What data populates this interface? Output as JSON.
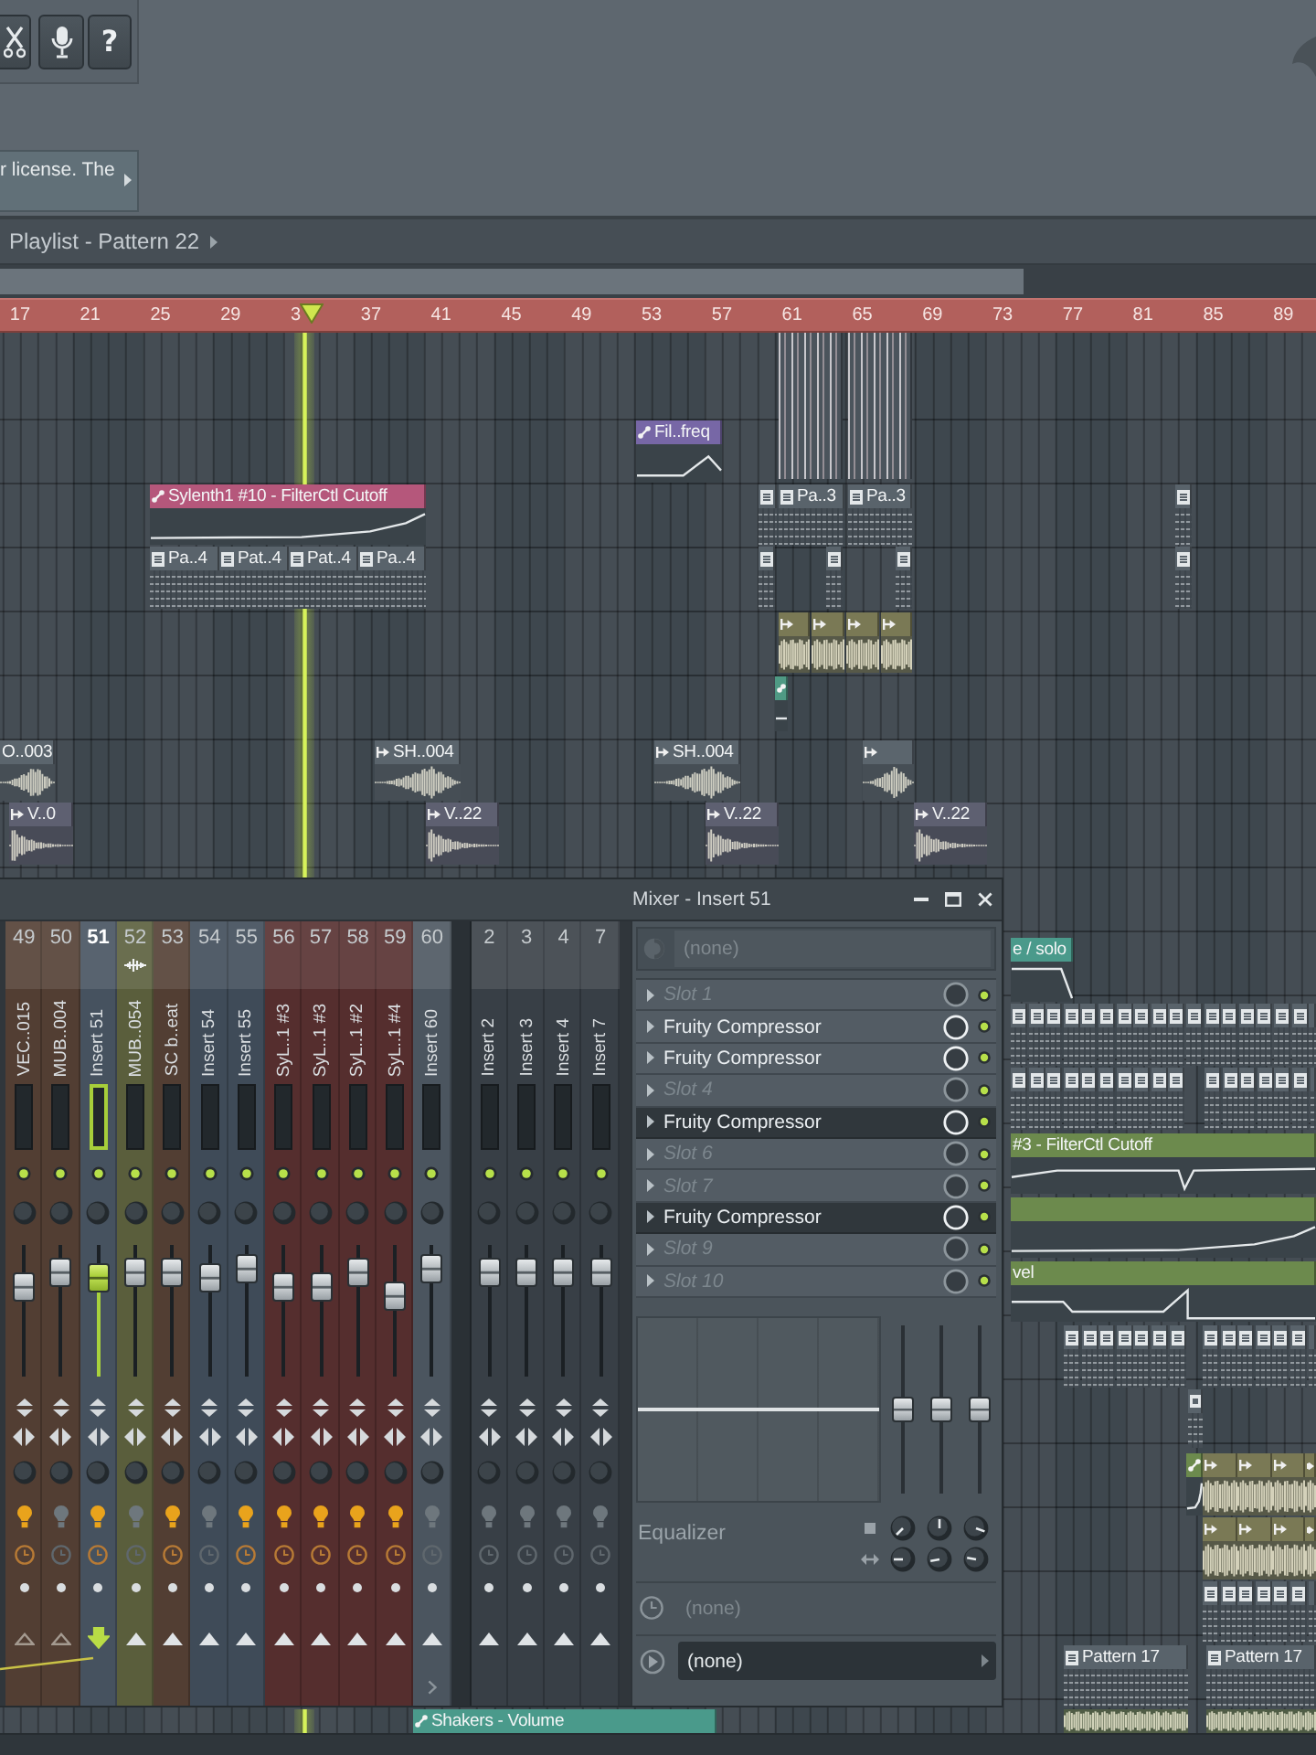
{
  "toolbar": {
    "help_label": "?",
    "hint": "r license. The"
  },
  "playlist": {
    "title": "Playlist - Pattern 22",
    "ruler": [
      "17",
      "21",
      "25",
      "29",
      "3",
      "37",
      "41",
      "45",
      "49",
      "53",
      "57",
      "61",
      "65",
      "69",
      "73",
      "77",
      "81",
      "85",
      "89"
    ],
    "tracks": [
      {
        "clips": [
          {
            "kind": "notes",
            "color": "#4b545c"
          },
          {
            "kind": "notes",
            "color": "#4b545c"
          }
        ]
      },
      {
        "clips": [
          {
            "kind": "automation",
            "label": "Fil..freq",
            "color": "#7767a6"
          }
        ]
      },
      {
        "clips": [
          {
            "kind": "automation",
            "label": "Sylenth1 #10 - FilterCtl Cutoff",
            "color": "#b5577b"
          },
          {
            "kind": "pattern",
            "color": "#59636b"
          },
          {
            "kind": "pattern",
            "label": "Pa..3",
            "color": "#59636b"
          },
          {
            "kind": "pattern",
            "label": "Pa..3",
            "color": "#59636b"
          },
          {
            "kind": "pattern",
            "color": "#59636b"
          }
        ]
      },
      {
        "clips": [
          {
            "kind": "pattern",
            "label": "Pa..4",
            "color": "#59636b"
          },
          {
            "kind": "pattern",
            "label": "Pat..4",
            "color": "#59636b"
          },
          {
            "kind": "pattern",
            "label": "Pat..4",
            "color": "#59636b"
          },
          {
            "kind": "pattern",
            "label": "Pa..4",
            "color": "#59636b"
          },
          {
            "kind": "pattern",
            "color": "#59636b"
          },
          {
            "kind": "pattern",
            "color": "#59636b"
          },
          {
            "kind": "pattern",
            "color": "#59636b"
          },
          {
            "kind": "pattern",
            "color": "#59636b"
          }
        ]
      },
      {
        "clips": [
          {
            "kind": "audio",
            "color": "#7a7955"
          },
          {
            "kind": "audio",
            "color": "#7a7955"
          },
          {
            "kind": "audio",
            "color": "#7a7955"
          },
          {
            "kind": "audio",
            "color": "#7a7955"
          }
        ]
      },
      {
        "clips": [
          {
            "kind": "automation",
            "color": "#4f9a84"
          }
        ]
      },
      {
        "clips": [
          {
            "kind": "audio",
            "label": "O..003",
            "color": "#5b656d"
          },
          {
            "kind": "audio",
            "label": "SH..004",
            "color": "#5b656d"
          },
          {
            "kind": "audio",
            "label": "SH..004",
            "color": "#5b656d"
          },
          {
            "kind": "audio",
            "color": "#5b656d"
          }
        ]
      },
      {
        "clips": [
          {
            "kind": "audio",
            "label": "V..0",
            "color": "#5e6071"
          },
          {
            "kind": "audio",
            "label": "V..22",
            "color": "#5e6071"
          },
          {
            "kind": "audio",
            "label": "V..22",
            "color": "#5e6071"
          },
          {
            "kind": "audio",
            "label": "V..22",
            "color": "#5e6071"
          }
        ]
      },
      {
        "clips": [
          {
            "kind": "automation",
            "label": "e / solo",
            "color": "#4a9a8b"
          }
        ]
      },
      {
        "clips": [
          {
            "kind": "pattern",
            "color": "#59636b"
          },
          {
            "kind": "pattern",
            "color": "#59636b"
          },
          {
            "kind": "pattern",
            "color": "#59636b"
          },
          {
            "kind": "pattern",
            "color": "#59636b"
          },
          {
            "kind": "pattern",
            "color": "#59636b"
          },
          {
            "kind": "pattern",
            "color": "#59636b"
          },
          {
            "kind": "pattern",
            "color": "#59636b"
          },
          {
            "kind": "pattern",
            "color": "#59636b"
          },
          {
            "kind": "pattern",
            "color": "#59636b"
          },
          {
            "kind": "pattern",
            "color": "#59636b"
          },
          {
            "kind": "pattern",
            "color": "#59636b"
          },
          {
            "kind": "pattern",
            "color": "#59636b"
          },
          {
            "kind": "pattern",
            "color": "#59636b"
          },
          {
            "kind": "pattern",
            "color": "#59636b"
          },
          {
            "kind": "pattern",
            "color": "#59636b"
          },
          {
            "kind": "pattern",
            "color": "#59636b"
          },
          {
            "kind": "pattern",
            "color": "#59636b"
          },
          {
            "kind": "pattern",
            "color": "#59636b"
          }
        ]
      },
      {
        "clips": [
          {
            "kind": "pattern",
            "color": "#59636b"
          },
          {
            "kind": "pattern",
            "color": "#59636b"
          },
          {
            "kind": "pattern",
            "color": "#59636b"
          },
          {
            "kind": "pattern",
            "color": "#59636b"
          },
          {
            "kind": "pattern",
            "color": "#59636b"
          },
          {
            "kind": "pattern",
            "color": "#59636b"
          },
          {
            "kind": "pattern",
            "color": "#59636b"
          },
          {
            "kind": "pattern",
            "color": "#59636b"
          },
          {
            "kind": "pattern",
            "color": "#59636b"
          },
          {
            "kind": "pattern",
            "color": "#59636b"
          },
          {
            "kind": "pattern",
            "color": "#59636b"
          },
          {
            "kind": "pattern",
            "color": "#59636b"
          },
          {
            "kind": "pattern",
            "color": "#59636b"
          },
          {
            "kind": "pattern",
            "color": "#59636b"
          },
          {
            "kind": "pattern",
            "color": "#59636b"
          },
          {
            "kind": "pattern",
            "color": "#59636b"
          },
          {
            "kind": "pattern",
            "color": "#59636b"
          }
        ]
      },
      {
        "clips": [
          {
            "kind": "automation",
            "label": "#3 - FilterCtl Cutoff",
            "color": "#6c8a4d"
          }
        ]
      },
      {
        "clips": [
          {
            "kind": "automation",
            "color": "#6c8a4d"
          }
        ]
      },
      {
        "clips": [
          {
            "kind": "automation",
            "label": "vel",
            "color": "#6c8a4d"
          }
        ]
      },
      {
        "clips": [
          {
            "kind": "pattern",
            "color": "#59636b"
          },
          {
            "kind": "pattern",
            "color": "#59636b"
          },
          {
            "kind": "pattern",
            "color": "#59636b"
          },
          {
            "kind": "pattern",
            "color": "#59636b"
          },
          {
            "kind": "pattern",
            "color": "#59636b"
          },
          {
            "kind": "pattern",
            "color": "#59636b"
          },
          {
            "kind": "pattern",
            "color": "#59636b"
          },
          {
            "kind": "pattern",
            "color": "#59636b"
          },
          {
            "kind": "pattern",
            "color": "#59636b"
          },
          {
            "kind": "pattern",
            "color": "#59636b"
          },
          {
            "kind": "pattern",
            "color": "#59636b"
          },
          {
            "kind": "pattern",
            "color": "#59636b"
          },
          {
            "kind": "pattern",
            "color": "#59636b"
          },
          {
            "kind": "pattern",
            "color": "#59636b"
          }
        ]
      },
      {
        "clips": [
          {
            "kind": "pattern",
            "color": "#59636b"
          }
        ]
      },
      {
        "clips": [
          {
            "kind": "automation",
            "color": "#6c8a4d"
          },
          {
            "kind": "audio",
            "color": "#7a7955"
          },
          {
            "kind": "audio",
            "color": "#7a7955"
          },
          {
            "kind": "audio",
            "color": "#7a7955"
          },
          {
            "kind": "audio",
            "color": "#7a7955"
          }
        ]
      },
      {
        "clips": [
          {
            "kind": "audio",
            "color": "#7a7955"
          },
          {
            "kind": "audio",
            "color": "#7a7955"
          },
          {
            "kind": "audio",
            "color": "#7a7955"
          },
          {
            "kind": "audio",
            "color": "#7a7955"
          }
        ]
      },
      {
        "clips": [
          {
            "kind": "pattern",
            "color": "#59636b"
          },
          {
            "kind": "pattern",
            "color": "#59636b"
          },
          {
            "kind": "pattern",
            "color": "#59636b"
          },
          {
            "kind": "pattern",
            "color": "#59636b"
          },
          {
            "kind": "pattern",
            "color": "#59636b"
          },
          {
            "kind": "pattern",
            "color": "#59636b"
          },
          {
            "kind": "pattern",
            "color": "#59636b"
          }
        ]
      },
      {
        "clips": [
          {
            "kind": "pattern",
            "label": "Pattern 17",
            "color": "#59636b"
          },
          {
            "kind": "pattern",
            "label": "Pattern 17",
            "color": "#59636b"
          }
        ]
      },
      {
        "clips": [
          {
            "kind": "automation",
            "label": "Shakers - Volume",
            "color": "#4a9a8b"
          },
          {
            "kind": "audio",
            "color": "#6c7f50"
          },
          {
            "kind": "audio",
            "color": "#6c7f50"
          }
        ]
      }
    ]
  },
  "mixer": {
    "title": "Mixer - Insert 51",
    "groups": [
      {
        "strips": [
          {
            "number": "49",
            "name": "VEC..015",
            "color": "#523e33",
            "level": 0.68,
            "armed": true,
            "routed": true,
            "route_target": false,
            "selected": false
          },
          {
            "number": "50",
            "name": "MUB..004",
            "color": "#523e33",
            "level": 0.79,
            "armed": false,
            "routed": true,
            "route_target": false,
            "selected": false
          },
          {
            "number": "51",
            "name": "Insert 51",
            "color": "#46525f",
            "level": 0.75,
            "armed": true,
            "routed": false,
            "route_target": false,
            "selected": true
          },
          {
            "number": "52",
            "name": "MUB..054",
            "color": "#5a5e3c",
            "level": 0.79,
            "armed": false,
            "routed": false,
            "route_target": true,
            "selected": false
          },
          {
            "number": "53",
            "name": "SC b..eat",
            "color": "#523e33",
            "level": 0.79,
            "armed": true,
            "routed": false,
            "route_target": false,
            "selected": false
          },
          {
            "number": "54",
            "name": "Insert 54",
            "color": "#3f4b58",
            "level": 0.75,
            "armed": false,
            "routed": false,
            "route_target": false,
            "selected": false
          },
          {
            "number": "55",
            "name": "Insert 55",
            "color": "#3f4b58",
            "level": 0.82,
            "armed": true,
            "routed": false,
            "route_target": false,
            "selected": false
          },
          {
            "number": "56",
            "name": "SyL..1 #3",
            "color": "#552e2e",
            "level": 0.68,
            "armed": true,
            "routed": false,
            "route_target": false,
            "selected": false
          },
          {
            "number": "57",
            "name": "SyL..1 #3",
            "color": "#552e2e",
            "level": 0.68,
            "armed": true,
            "routed": false,
            "route_target": false,
            "selected": false
          },
          {
            "number": "58",
            "name": "SyL..1 #2",
            "color": "#552e2e",
            "level": 0.79,
            "armed": true,
            "routed": false,
            "route_target": false,
            "selected": false
          },
          {
            "number": "59",
            "name": "SyL..1 #4",
            "color": "#552e2e",
            "level": 0.61,
            "armed": true,
            "routed": false,
            "route_target": false,
            "selected": false
          },
          {
            "number": "60",
            "name": "Insert 60",
            "color": "#4b555f",
            "level": 0.82,
            "armed": false,
            "routed": false,
            "route_target": false,
            "selected": false
          }
        ]
      },
      {
        "strips": [
          {
            "number": "2",
            "name": "Insert 2",
            "color": "#383f46",
            "level": 0.79,
            "armed": false,
            "routed": false,
            "route_target": false,
            "selected": false
          },
          {
            "number": "3",
            "name": "Insert 3",
            "color": "#383f46",
            "level": 0.79,
            "armed": false,
            "routed": false,
            "route_target": false,
            "selected": false
          },
          {
            "number": "4",
            "name": "Insert 4",
            "color": "#383f46",
            "level": 0.79,
            "armed": false,
            "routed": false,
            "route_target": false,
            "selected": false
          },
          {
            "number": "7",
            "name": "Insert 7",
            "color": "#383f46",
            "level": 0.79,
            "armed": false,
            "routed": false,
            "route_target": false,
            "selected": false
          }
        ]
      }
    ],
    "insert": {
      "input": "(none)",
      "slots": [
        {
          "label": "Slot 1",
          "kind": "empty",
          "highlighted": false
        },
        {
          "label": "Fruity Compressor",
          "kind": "plugin",
          "highlighted": false
        },
        {
          "label": "Fruity Compressor",
          "kind": "plugin",
          "highlighted": false
        },
        {
          "label": "Slot 4",
          "kind": "empty",
          "highlighted": false
        },
        {
          "label": "Fruity Compressor",
          "kind": "plugin",
          "highlighted": true
        },
        {
          "label": "Slot 6",
          "kind": "empty",
          "highlighted": false
        },
        {
          "label": "Slot 7",
          "kind": "empty",
          "highlighted": false
        },
        {
          "label": "Fruity Compressor",
          "kind": "plugin",
          "highlighted": true
        },
        {
          "label": "Slot 9",
          "kind": "empty",
          "highlighted": false
        },
        {
          "label": "Slot 10",
          "kind": "empty",
          "highlighted": false
        }
      ],
      "eq_bands": [
        {
          "level": 0.5
        },
        {
          "level": 0.5
        },
        {
          "level": 0.5
        }
      ],
      "eq_label": "Equalizer",
      "latency": "(none)",
      "output": "(none)"
    }
  }
}
